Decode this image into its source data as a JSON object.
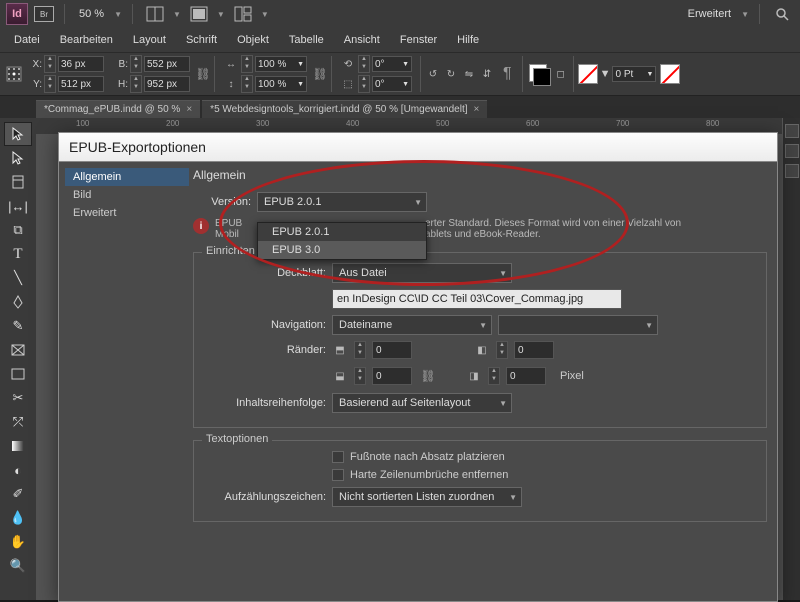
{
  "topbar": {
    "br_label": "Br",
    "zoom": "50 %",
    "workspace": "Erweitert"
  },
  "menu": [
    "Datei",
    "Bearbeiten",
    "Layout",
    "Schrift",
    "Objekt",
    "Tabelle",
    "Ansicht",
    "Fenster",
    "Hilfe"
  ],
  "control": {
    "x": "36 px",
    "y": "512 px",
    "w": "552 px",
    "h": "952 px",
    "sx": "100 %",
    "sy": "100 %",
    "rot": "0°",
    "shear": "0°",
    "stroke": "0 Pt"
  },
  "tabs": [
    {
      "label": "*Commag_ePUB.indd @ 50 %",
      "active": true
    },
    {
      "label": "*5 Webdesigntools_korrigiert.indd @ 50 % [Umgewandelt]",
      "active": false
    }
  ],
  "ruler": [
    "100",
    "200",
    "300",
    "400",
    "500",
    "600",
    "700",
    "800"
  ],
  "dialog": {
    "title": "EPUB-Exportoptionen",
    "nav": [
      "Allgemein",
      "Bild",
      "Erweitert"
    ],
    "heading": "Allgemein",
    "version_label": "Version:",
    "version_value": "EPUB 2.0.1",
    "version_options": [
      "EPUB 2.0.1",
      "EPUB 3.0"
    ],
    "info_prefix": "EPUB",
    "info_line1": "Mobil",
    "info_right1": "erter Standard. Dieses Format wird von einer Vielzahl von",
    "info_right2": "ablets und eBook-Reader.",
    "einrichten": {
      "legend": "Einrichten",
      "deckblatt_label": "Deckblatt:",
      "deckblatt_value": "Aus Datei",
      "deckblatt_path": "en InDesign CC\\ID CC Teil 03\\Cover_Commag.jpg",
      "navigation_label": "Navigation:",
      "navigation_value": "Dateiname",
      "raender_label": "Ränder:",
      "margin_vals": [
        "0",
        "0",
        "0",
        "0"
      ],
      "pixel": "Pixel",
      "reihenfolge_label": "Inhaltsreihenfolge:",
      "reihenfolge_value": "Basierend auf Seitenlayout"
    },
    "textopt": {
      "legend": "Textoptionen",
      "chk1": "Fußnote nach Absatz platzieren",
      "chk2": "Harte Zeilenumbrüche entfernen",
      "aufz_label": "Aufzählungszeichen:",
      "aufz_value": "Nicht sortierten Listen zuordnen"
    }
  }
}
